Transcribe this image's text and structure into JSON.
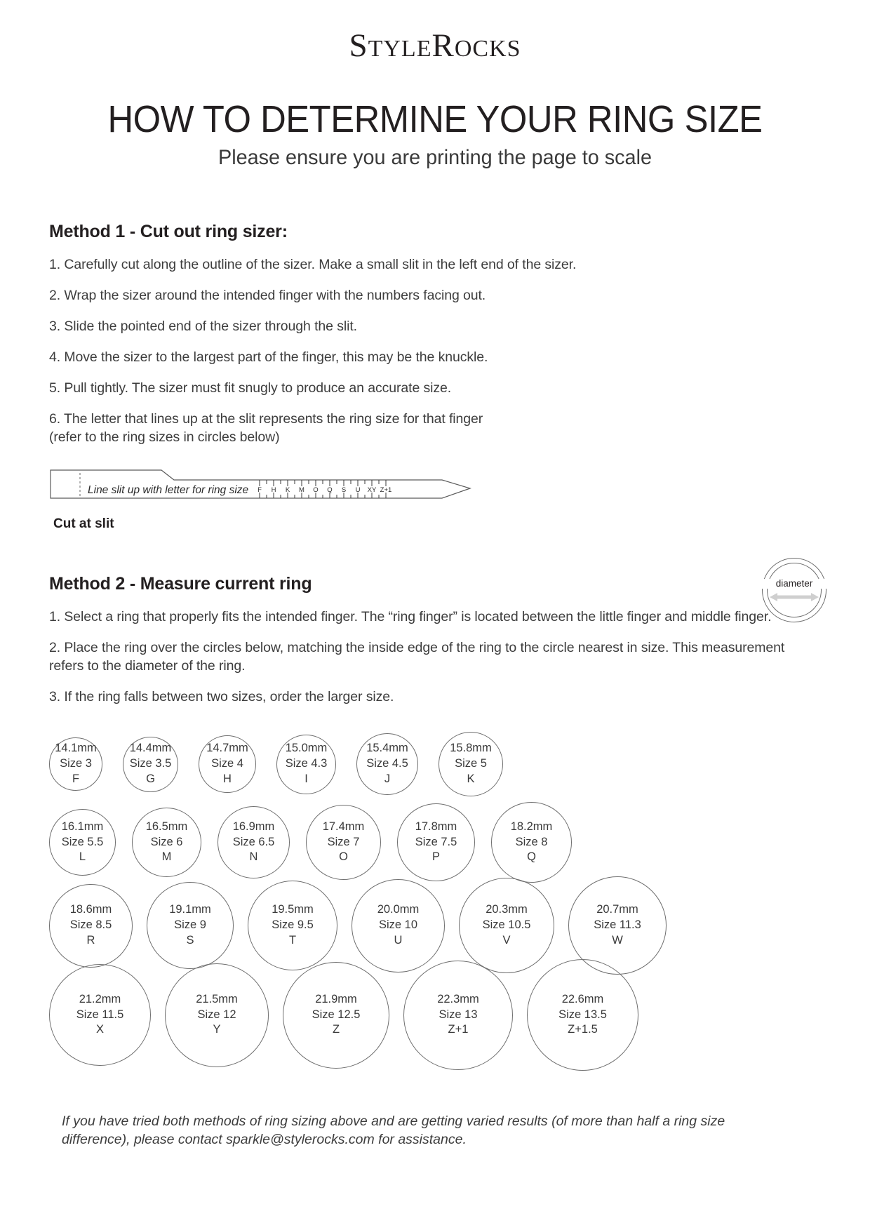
{
  "brand": {
    "name": "StyleRocks",
    "part1": "S",
    "part2": "TYLE",
    "part3": "R",
    "part4": "OCKS"
  },
  "header": {
    "title": "HOW TO DETERMINE YOUR RING SIZE",
    "subtitle": "Please ensure you are printing the page to scale"
  },
  "method1": {
    "heading": "Method 1 - Cut out ring sizer:",
    "steps": [
      "1. Carefully cut along the outline of the sizer. Make a small slit in the left end of the sizer.",
      "2. Wrap the sizer around the intended finger with the numbers facing out.",
      "3. Slide the pointed end of the sizer through the slit.",
      "4. Move the sizer to the largest part of the finger, this may be the knuckle.",
      "5. Pull tightly. The sizer must fit snugly to produce an accurate size.",
      "6. The letter that lines up at the slit represents the ring size for that finger\n(refer to the ring sizes in circles below)"
    ],
    "sizer": {
      "instruction": "Line slit up with letter for ring size",
      "scale_letters": [
        "F",
        "H",
        "K",
        "M",
        "O",
        "Q",
        "S",
        "U",
        "XY",
        "Z+1"
      ],
      "cut_label": "Cut at slit"
    }
  },
  "method2": {
    "heading": "Method 2 - Measure current ring",
    "steps": [
      "1. Select a ring that properly fits the intended finger. The “ring finger” is located between the little finger and middle finger.",
      "2. Place the ring over the circles below, matching the inside edge of the ring to the circle nearest in size. This measurement refers to the diameter of the ring.",
      "3. If the ring falls between two sizes, order the larger size."
    ],
    "diameter_badge": {
      "label": "diameter"
    }
  },
  "ring_sizes": {
    "rows": [
      [
        {
          "mm": "14.1mm",
          "size": "Size 3",
          "letter": "F",
          "d": 76
        },
        {
          "mm": "14.4mm",
          "size": "Size 3.5",
          "letter": "G",
          "d": 79
        },
        {
          "mm": "14.7mm",
          "size": "Size 4",
          "letter": "H",
          "d": 82
        },
        {
          "mm": "15.0mm",
          "size": "Size 4.3",
          "letter": "I",
          "d": 85
        },
        {
          "mm": "15.4mm",
          "size": "Size 4.5",
          "letter": "J",
          "d": 88
        },
        {
          "mm": "15.8mm",
          "size": "Size 5",
          "letter": "K",
          "d": 92
        }
      ],
      [
        {
          "mm": "16.1mm",
          "size": "Size 5.5",
          "letter": "L",
          "d": 95
        },
        {
          "mm": "16.5mm",
          "size": "Size 6",
          "letter": "M",
          "d": 99
        },
        {
          "mm": "16.9mm",
          "size": "Size 6.5",
          "letter": "N",
          "d": 103
        },
        {
          "mm": "17.4mm",
          "size": "Size 7",
          "letter": "O",
          "d": 107
        },
        {
          "mm": "17.8mm",
          "size": "Size 7.5",
          "letter": "P",
          "d": 111
        },
        {
          "mm": "18.2mm",
          "size": "Size 8",
          "letter": "Q",
          "d": 115
        }
      ],
      [
        {
          "mm": "18.6mm",
          "size": "Size 8.5",
          "letter": "R",
          "d": 119
        },
        {
          "mm": "19.1mm",
          "size": "Size 9",
          "letter": "S",
          "d": 124
        },
        {
          "mm": "19.5mm",
          "size": "Size 9.5",
          "letter": "T",
          "d": 128
        },
        {
          "mm": "20.0mm",
          "size": "Size 10",
          "letter": "U",
          "d": 133
        },
        {
          "mm": "20.3mm",
          "size": "Size 10.5",
          "letter": "V",
          "d": 136
        },
        {
          "mm": "20.7mm",
          "size": "Size 11.3",
          "letter": "W",
          "d": 140
        }
      ],
      [
        {
          "mm": "21.2mm",
          "size": "Size 11.5",
          "letter": "X",
          "d": 145
        },
        {
          "mm": "21.5mm",
          "size": "Size 12",
          "letter": "Y",
          "d": 148
        },
        {
          "mm": "21.9mm",
          "size": "Size 12.5",
          "letter": "Z",
          "d": 152
        },
        {
          "mm": "22.3mm",
          "size": "Size 13",
          "letter": "Z+1",
          "d": 156
        },
        {
          "mm": "22.6mm",
          "size": "Size 13.5",
          "letter": "Z+1.5",
          "d": 159
        }
      ]
    ]
  },
  "footer": {
    "text": "If you have tried both methods of ring sizing above and are getting varied results (of more than half a ring size difference), please contact sparkle@stylerocks.com for assistance."
  }
}
